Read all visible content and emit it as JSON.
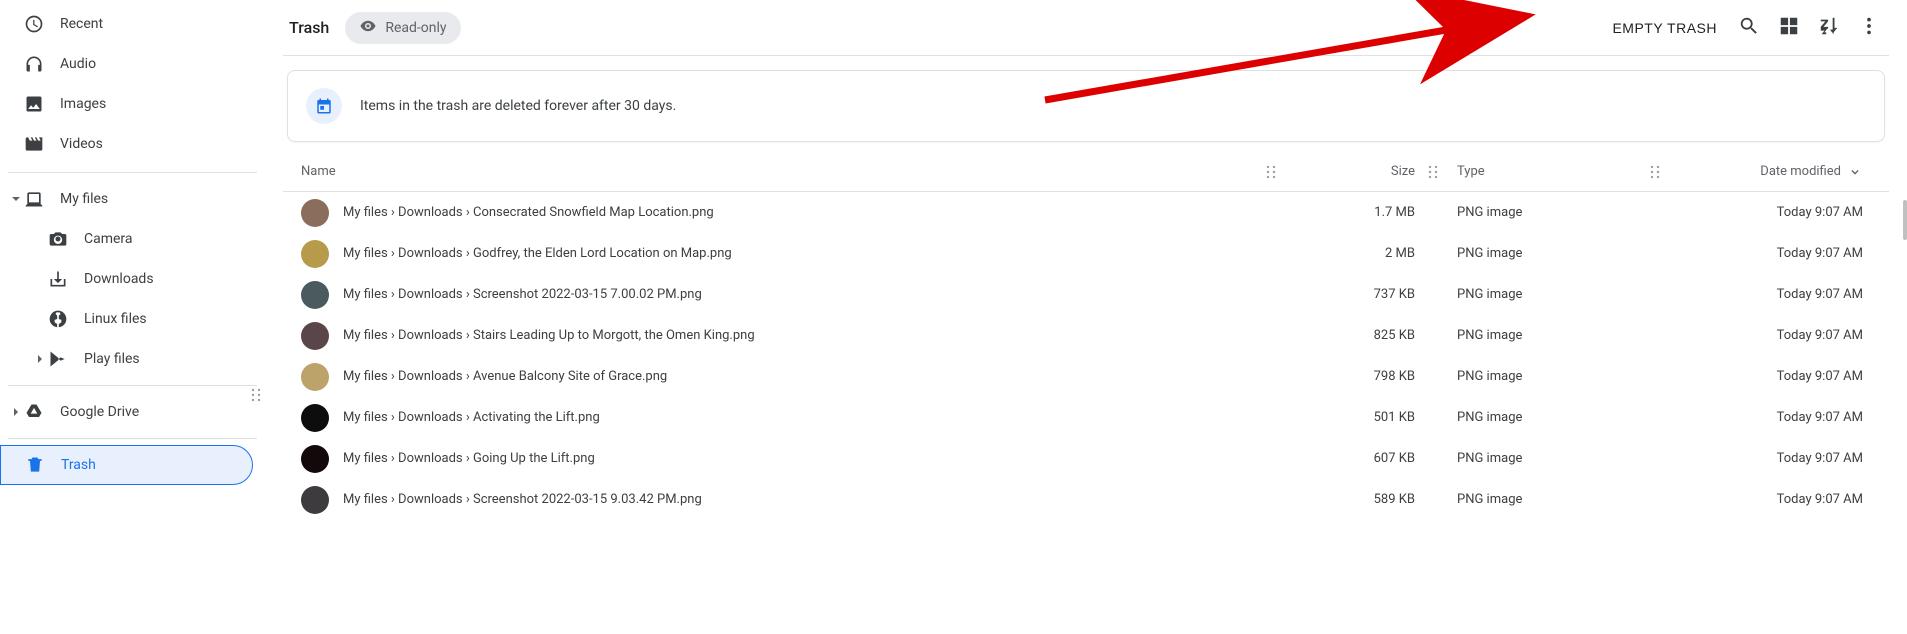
{
  "sidebar": {
    "top_items": [
      {
        "id": "recent",
        "label": "Recent",
        "icon": "clock"
      },
      {
        "id": "audio",
        "label": "Audio",
        "icon": "headphones"
      },
      {
        "id": "images",
        "label": "Images",
        "icon": "image"
      },
      {
        "id": "videos",
        "label": "Videos",
        "icon": "video"
      }
    ],
    "my_files": {
      "label": "My files",
      "icon": "laptop",
      "expanded": true
    },
    "my_files_children": [
      {
        "id": "camera",
        "label": "Camera",
        "icon": "camera"
      },
      {
        "id": "downloads",
        "label": "Downloads",
        "icon": "download"
      },
      {
        "id": "linux",
        "label": "Linux files",
        "icon": "linux"
      },
      {
        "id": "play",
        "label": "Play files",
        "icon": "play"
      }
    ],
    "drive": {
      "label": "Google Drive",
      "icon": "drive"
    },
    "trash": {
      "label": "Trash",
      "icon": "trash"
    }
  },
  "header": {
    "title": "Trash",
    "chip_label": "Read-only",
    "empty_trash": "EMPTY TRASH"
  },
  "banner": {
    "text": "Items in the trash are deleted forever after 30 days."
  },
  "columns": {
    "name": "Name",
    "size": "Size",
    "type": "Type",
    "date": "Date modified"
  },
  "rows": [
    {
      "thumb": "#8a6d5a",
      "name": "My files › Downloads › Consecrated Snowfield Map Location.png",
      "size": "1.7 MB",
      "type": "PNG image",
      "date": "Today 9:07 AM"
    },
    {
      "thumb": "#b89b4a",
      "name": "My files › Downloads › Godfrey, the Elden Lord Location on Map.png",
      "size": "2 MB",
      "type": "PNG image",
      "date": "Today 9:07 AM"
    },
    {
      "thumb": "#4a5a5f",
      "name": "My files › Downloads › Screenshot 2022-03-15 7.00.02 PM.png",
      "size": "737 KB",
      "type": "PNG image",
      "date": "Today 9:07 AM"
    },
    {
      "thumb": "#5a4648",
      "name": "My files › Downloads › Stairs Leading Up to Morgott, the Omen King.png",
      "size": "825 KB",
      "type": "PNG image",
      "date": "Today 9:07 AM"
    },
    {
      "thumb": "#bba36a",
      "name": "My files › Downloads › Avenue Balcony Site of Grace.png",
      "size": "798 KB",
      "type": "PNG image",
      "date": "Today 9:07 AM"
    },
    {
      "thumb": "#0d0d0d",
      "name": "My files › Downloads › Activating the Lift.png",
      "size": "501 KB",
      "type": "PNG image",
      "date": "Today 9:07 AM"
    },
    {
      "thumb": "#120a0a",
      "name": "My files › Downloads › Going Up the Lift.png",
      "size": "607 KB",
      "type": "PNG image",
      "date": "Today 9:07 AM"
    },
    {
      "thumb": "#3d3b3e",
      "name": "My files › Downloads › Screenshot 2022-03-15 9.03.42 PM.png",
      "size": "589 KB",
      "type": "PNG image",
      "date": "Today 9:07 AM"
    }
  ]
}
